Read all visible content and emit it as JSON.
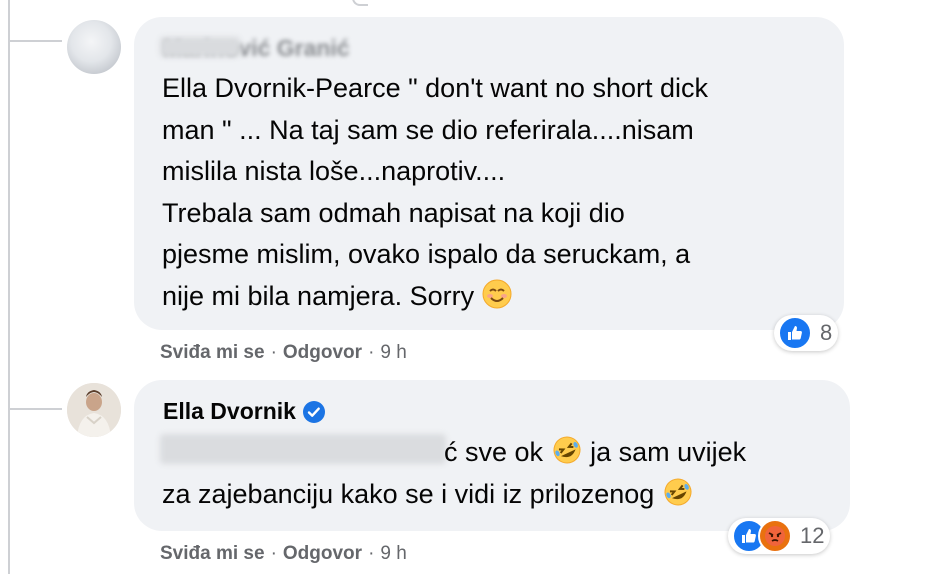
{
  "comments": [
    {
      "author": "Marinović Granić",
      "lines": [
        "Ella Dvornik-Pearce \" don't want no short dick",
        "man \" ... Na taj sam se dio referirala....nisam",
        "mislila nista loše...naprotiv....",
        "Trebala sam odmah napisat na koji dio",
        "pjesme mislim, ovako ispalo da seruckam, a",
        "nije mi bila namjera. Sorry"
      ],
      "emoji": "smiling-face",
      "reaction_count": "8",
      "actions": {
        "like": "Sviđa mi se",
        "reply": "Odgovor",
        "time": "9 h"
      }
    },
    {
      "author": "Ella Dvornik",
      "verified_badge": "verified-badge-icon",
      "line1_tail": "ć sve ok",
      "line1_after": "ja sam uvijek",
      "line2": "za zajebanciju kako se i vidi iz prilozenog",
      "reaction_count": "12",
      "actions": {
        "like": "Sviđa mi se",
        "reply": "Odgovor",
        "time": "9 h"
      }
    }
  ],
  "colors": {
    "bubble": "#f0f2f5",
    "like_blue": "#1877f2",
    "verified_blue": "#1b74e4",
    "meta_gray": "#65676b"
  }
}
